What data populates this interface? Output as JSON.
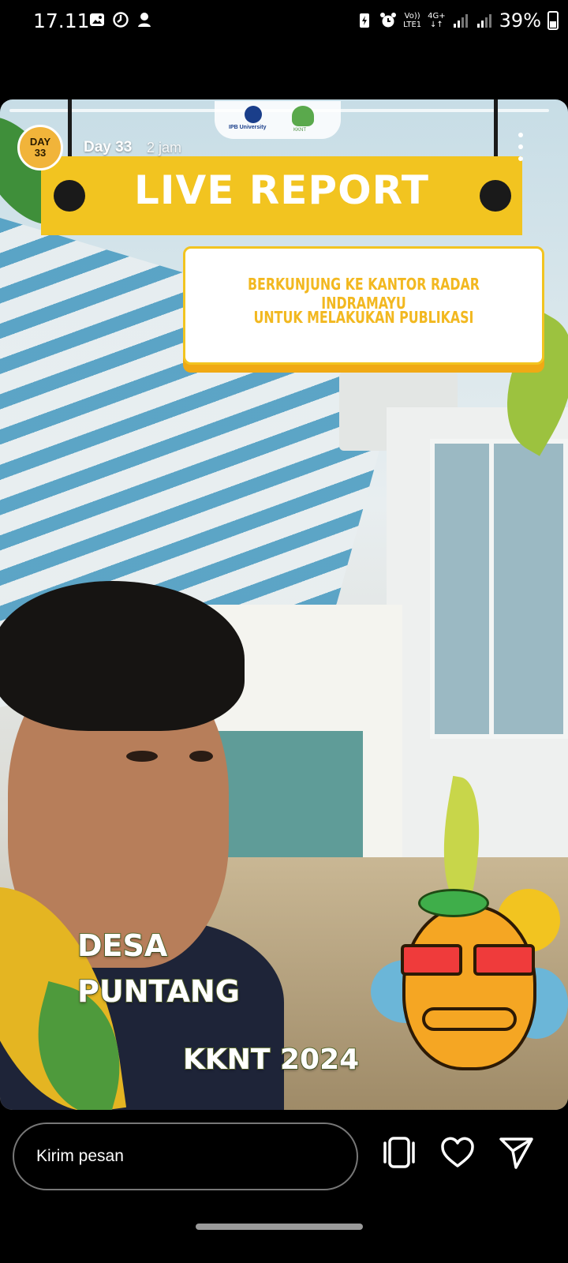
{
  "status_bar": {
    "time": "17.11",
    "volte": "Vo))",
    "lte": "LTE1",
    "network": "4G+",
    "battery": "39%"
  },
  "story": {
    "user": "Day 33",
    "avatar_text": "DAY\n33",
    "time_ago": "2 jam",
    "logo_1_text": "IPB University",
    "logo_2_text": "KKNT",
    "sign_title": "LIVE REPORT",
    "card_line_1": "BERKUNJUNG KE KANTOR RADAR INDRAMAYU",
    "card_line_2": "UNTUK MELAKUKAN PUBLIKASI",
    "caption_line_1": "DESA",
    "caption_line_2": "PUNTANG",
    "caption_kknt": "KKNT 2024"
  },
  "reply": {
    "placeholder": "Kirim pesan"
  },
  "icons": {
    "more": "more-vertical-icon",
    "sticker": "sticker-icon",
    "like": "heart-icon",
    "share": "send-icon"
  }
}
